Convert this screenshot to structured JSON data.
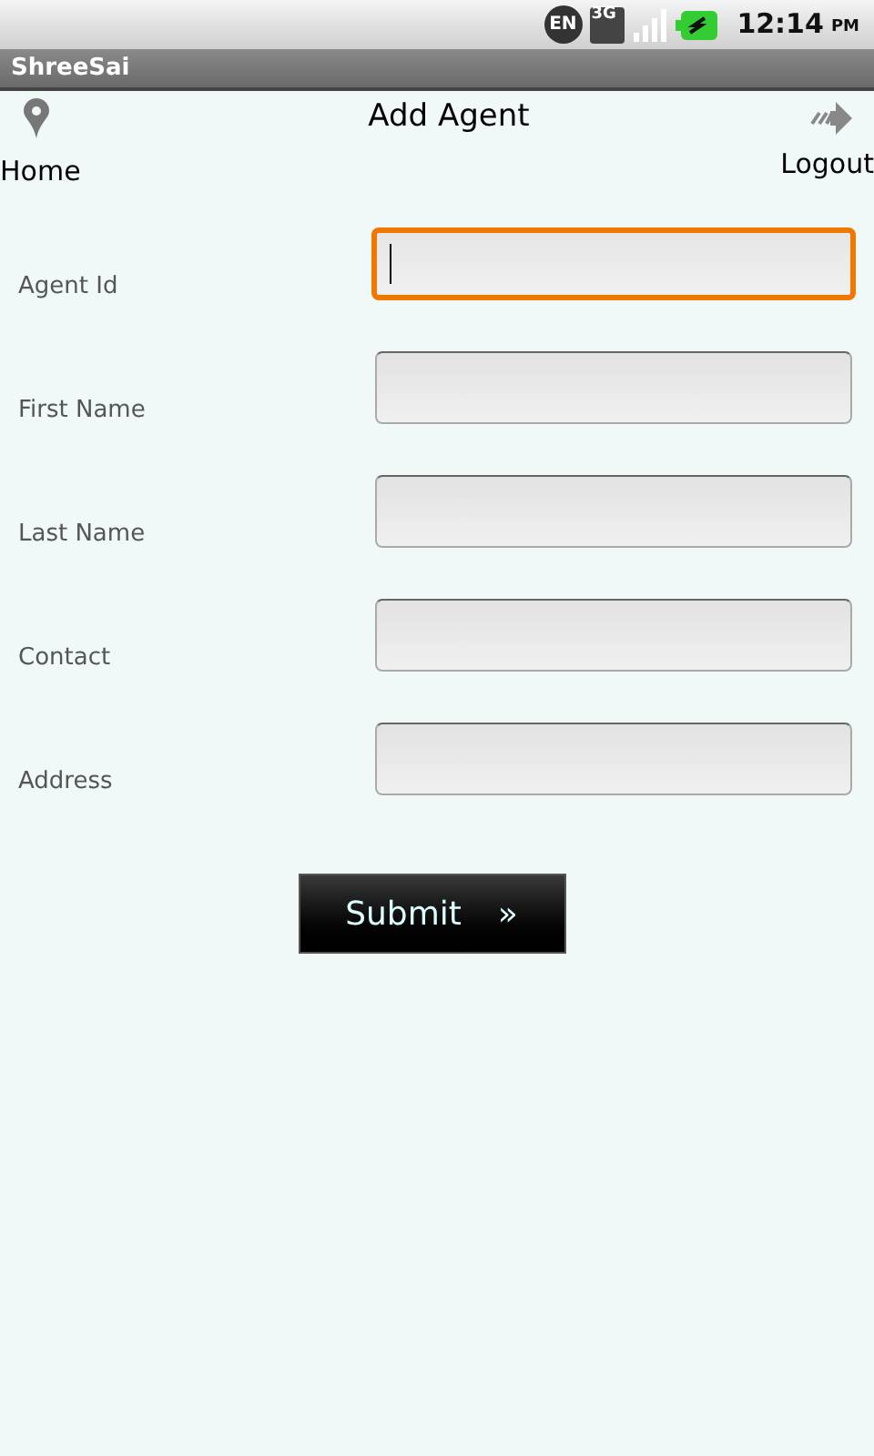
{
  "status_bar": {
    "language": "EN",
    "network": "3G",
    "time": "12:14",
    "ampm": "PM"
  },
  "app_bar": {
    "title": "ShreeSai"
  },
  "toolbar": {
    "home": "Home",
    "title": "Add Agent",
    "logout": "Logout"
  },
  "fields": [
    {
      "label": "Agent Id",
      "focused": true
    },
    {
      "label": "First Name",
      "focused": false
    },
    {
      "label": "Last Name",
      "focused": false
    },
    {
      "label": "Contact",
      "focused": false
    },
    {
      "label": "Address",
      "focused": false
    }
  ],
  "submit": {
    "label": "Submit",
    "arrow": "»"
  }
}
